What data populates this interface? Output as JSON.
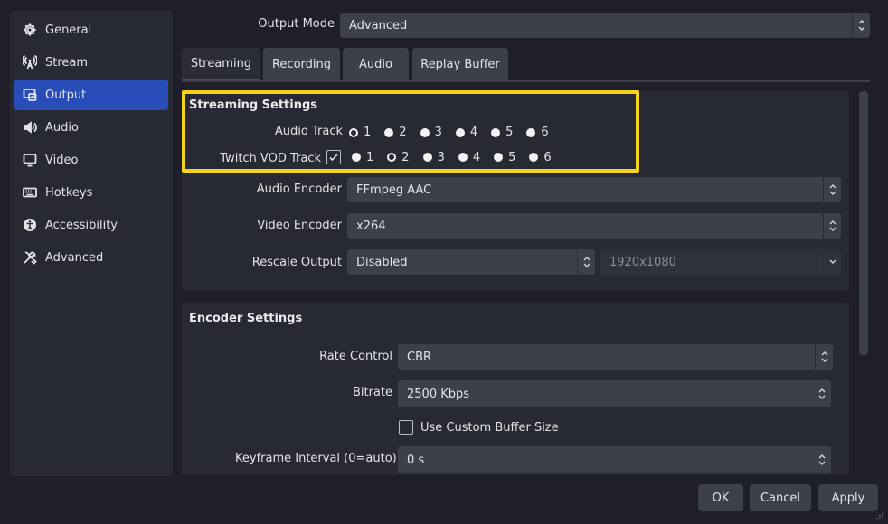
{
  "sidebar": {
    "items": [
      {
        "label": "General",
        "icon": "gear-icon"
      },
      {
        "label": "Stream",
        "icon": "antenna-icon"
      },
      {
        "label": "Output",
        "icon": "output-icon",
        "active": true
      },
      {
        "label": "Audio",
        "icon": "speaker-icon"
      },
      {
        "label": "Video",
        "icon": "monitor-icon"
      },
      {
        "label": "Hotkeys",
        "icon": "keyboard-icon"
      },
      {
        "label": "Accessibility",
        "icon": "accessibility-icon"
      },
      {
        "label": "Advanced",
        "icon": "tools-icon"
      }
    ]
  },
  "output_mode": {
    "label": "Output Mode",
    "value": "Advanced"
  },
  "tabs": [
    "Streaming",
    "Recording",
    "Audio",
    "Replay Buffer"
  ],
  "streaming_settings": {
    "title": "Streaming Settings",
    "audio_track": {
      "label": "Audio Track",
      "options": [
        "1",
        "2",
        "3",
        "4",
        "5",
        "6"
      ],
      "selected": "1"
    },
    "twitch_vod_track": {
      "label": "Twitch VOD Track",
      "checked": true,
      "options": [
        "1",
        "2",
        "3",
        "4",
        "5",
        "6"
      ],
      "selected": "2"
    },
    "audio_encoder": {
      "label": "Audio Encoder",
      "value": "FFmpeg AAC"
    },
    "video_encoder": {
      "label": "Video Encoder",
      "value": "x264"
    },
    "rescale_output": {
      "label": "Rescale Output",
      "value": "Disabled",
      "resolution": "1920x1080"
    }
  },
  "encoder_settings": {
    "title": "Encoder Settings",
    "rate_control": {
      "label": "Rate Control",
      "value": "CBR"
    },
    "bitrate": {
      "label": "Bitrate",
      "value": "2500 Kbps"
    },
    "custom_buffer": {
      "label": "Use Custom Buffer Size",
      "checked": false
    },
    "keyframe_interval": {
      "label": "Keyframe Interval (0=auto)",
      "value": "0 s"
    }
  },
  "buttons": {
    "ok": "OK",
    "cancel": "Cancel",
    "apply": "Apply"
  },
  "colors": {
    "accent": "#284cb8",
    "highlight": "#f5d21f",
    "background": "#1e1f29"
  }
}
